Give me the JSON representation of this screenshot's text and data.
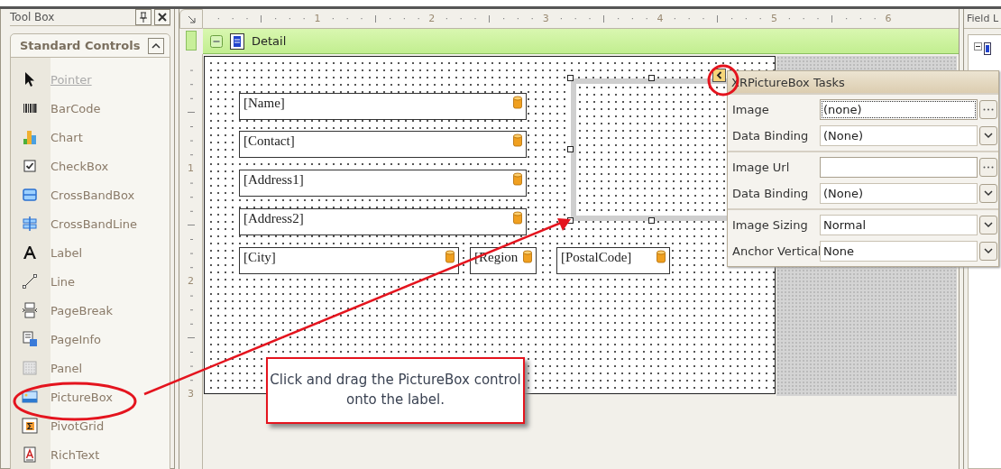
{
  "toolbox": {
    "title": "Tool Box",
    "group": {
      "title": "Standard Controls",
      "expanded": true
    },
    "items": [
      {
        "label": "Pointer",
        "kind": "pointer",
        "selected": true
      },
      {
        "label": "BarCode",
        "kind": "barcode",
        "selected": false
      },
      {
        "label": "Chart",
        "kind": "chart",
        "selected": false
      },
      {
        "label": "CheckBox",
        "kind": "checkbox",
        "selected": false
      },
      {
        "label": "CrossBandBox",
        "kind": "crossbandbox",
        "selected": false
      },
      {
        "label": "CrossBandLine",
        "kind": "crossbandline",
        "selected": false
      },
      {
        "label": "Label",
        "kind": "label",
        "selected": false
      },
      {
        "label": "Line",
        "kind": "line",
        "selected": false
      },
      {
        "label": "PageBreak",
        "kind": "pagebreak",
        "selected": false
      },
      {
        "label": "PageInfo",
        "kind": "pageinfo",
        "selected": false
      },
      {
        "label": "Panel",
        "kind": "panel",
        "selected": false
      },
      {
        "label": "PictureBox",
        "kind": "picturebox",
        "selected": false
      },
      {
        "label": "PivotGrid",
        "kind": "pivotgrid",
        "selected": false
      },
      {
        "label": "RichText",
        "kind": "richtext",
        "selected": false
      }
    ]
  },
  "designer": {
    "top_ruler": [
      "1",
      "2",
      "3",
      "4",
      "5",
      "6"
    ],
    "left_ruler": [
      "1",
      "2",
      "3"
    ],
    "band": {
      "title": "Detail",
      "expanded": true
    },
    "fields": [
      {
        "text": "[Name]"
      },
      {
        "text": "[Contact]"
      },
      {
        "text": "[Address1]"
      },
      {
        "text": "[Address2]"
      },
      {
        "text": "[City]"
      },
      {
        "text": "[Region"
      },
      {
        "text": "[PostalCode]"
      }
    ],
    "picture_box": {
      "selected": true
    },
    "tasks": {
      "title": "XRPictureBox Tasks",
      "groups": [
        [
          {
            "label": "Image",
            "value": "(none)",
            "kind": "browse",
            "focused": true
          },
          {
            "label": "Data Binding",
            "value": "(None)",
            "kind": "dropdown",
            "focused": false
          }
        ],
        [
          {
            "label": "Image Url",
            "kind": "browse",
            "focused": false
          },
          {
            "label": "Data Binding",
            "value": "(None)",
            "kind": "dropdown",
            "focused": false
          }
        ],
        [
          {
            "label": "Image Sizing",
            "value": "Normal",
            "kind": "dropdown",
            "focused": false
          },
          {
            "label": "Anchor Vertical",
            "value": "None",
            "kind": "dropdown",
            "focused": false
          }
        ]
      ]
    }
  },
  "callout": {
    "text": "Click and drag the PictureBox control onto the label."
  },
  "field_list": {
    "title": "Field L",
    "expanded": true
  }
}
